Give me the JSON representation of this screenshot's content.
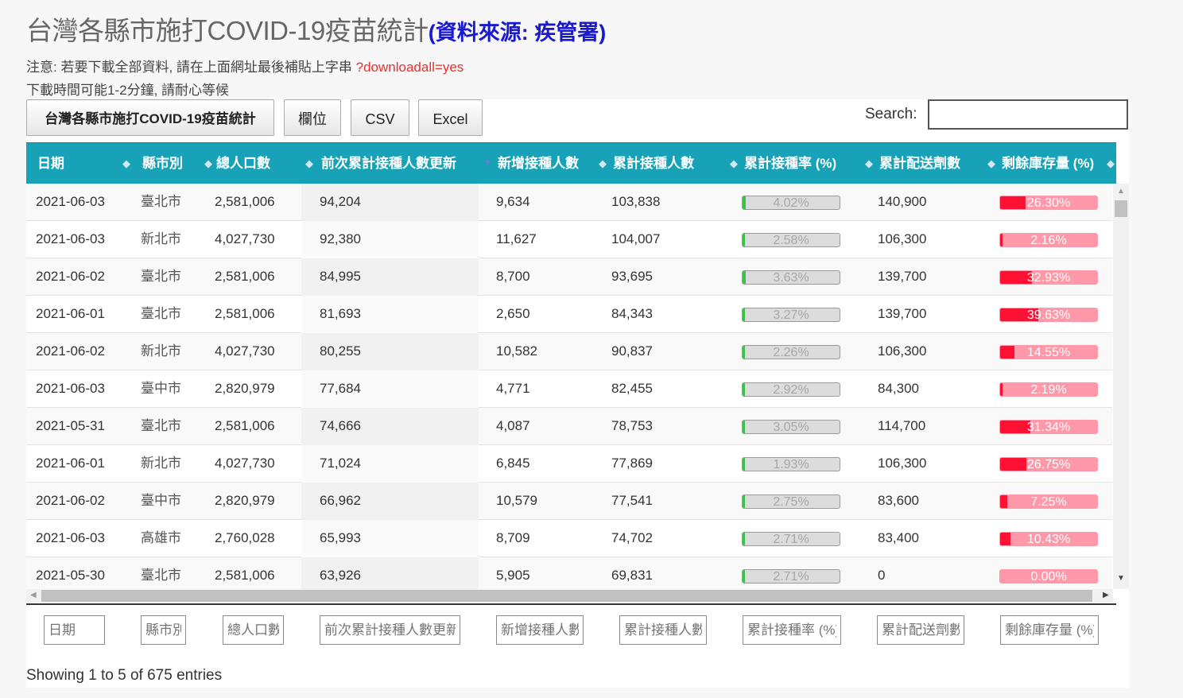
{
  "header": {
    "title": "台灣各縣市施打COVID-19疫苗統計",
    "source": "(資料來源: 疾管署)",
    "note1_prefix": "注意: 若要下載全部資料, 請在上面網址最後補貼上字串",
    "note1_query": "?downloadall=yes",
    "note2": "下載時間可能1-2分鐘, 請耐心等候"
  },
  "toolbar": {
    "title_button": "台灣各縣市施打COVID-19疫苗統計",
    "columns_button": "欄位",
    "csv_button": "CSV",
    "excel_button": "Excel",
    "search_label": "Search:",
    "search_value": ""
  },
  "table": {
    "columns": [
      "日期",
      "縣市別",
      "總人口數",
      "前次累計接種人數更新",
      "新增接種人數",
      "累計接種人數",
      "累計接種率 (%)",
      "累計配送劑數",
      "剩餘庫存量 (%)"
    ],
    "sorted_column": "前次累計接種人數更新",
    "sort_direction": "descending",
    "rows": [
      {
        "date": "2021-06-03",
        "city": "臺北市",
        "pop": "2,581,006",
        "prev": "94,204",
        "new": "9,634",
        "cum": "103,838",
        "rate": "4.02%",
        "rate_value": 4.02,
        "dist": "140,900",
        "stock": "26.30%",
        "stock_value": 26.3
      },
      {
        "date": "2021-06-03",
        "city": "新北市",
        "pop": "4,027,730",
        "prev": "92,380",
        "new": "11,627",
        "cum": "104,007",
        "rate": "2.58%",
        "rate_value": 2.58,
        "dist": "106,300",
        "stock": "2.16%",
        "stock_value": 2.16
      },
      {
        "date": "2021-06-02",
        "city": "臺北市",
        "pop": "2,581,006",
        "prev": "84,995",
        "new": "8,700",
        "cum": "93,695",
        "rate": "3.63%",
        "rate_value": 3.63,
        "dist": "139,700",
        "stock": "32.93%",
        "stock_value": 32.93
      },
      {
        "date": "2021-06-01",
        "city": "臺北市",
        "pop": "2,581,006",
        "prev": "81,693",
        "new": "2,650",
        "cum": "84,343",
        "rate": "3.27%",
        "rate_value": 3.27,
        "dist": "139,700",
        "stock": "39.63%",
        "stock_value": 39.63
      },
      {
        "date": "2021-06-02",
        "city": "新北市",
        "pop": "4,027,730",
        "prev": "80,255",
        "new": "10,582",
        "cum": "90,837",
        "rate": "2.26%",
        "rate_value": 2.26,
        "dist": "106,300",
        "stock": "14.55%",
        "stock_value": 14.55
      },
      {
        "date": "2021-06-03",
        "city": "臺中市",
        "pop": "2,820,979",
        "prev": "77,684",
        "new": "4,771",
        "cum": "82,455",
        "rate": "2.92%",
        "rate_value": 2.92,
        "dist": "84,300",
        "stock": "2.19%",
        "stock_value": 2.19
      },
      {
        "date": "2021-05-31",
        "city": "臺北市",
        "pop": "2,581,006",
        "prev": "74,666",
        "new": "4,087",
        "cum": "78,753",
        "rate": "3.05%",
        "rate_value": 3.05,
        "dist": "114,700",
        "stock": "31.34%",
        "stock_value": 31.34
      },
      {
        "date": "2021-06-01",
        "city": "新北市",
        "pop": "4,027,730",
        "prev": "71,024",
        "new": "6,845",
        "cum": "77,869",
        "rate": "1.93%",
        "rate_value": 1.93,
        "dist": "106,300",
        "stock": "26.75%",
        "stock_value": 26.75
      },
      {
        "date": "2021-06-02",
        "city": "臺中市",
        "pop": "2,820,979",
        "prev": "66,962",
        "new": "10,579",
        "cum": "77,541",
        "rate": "2.75%",
        "rate_value": 2.75,
        "dist": "83,600",
        "stock": "7.25%",
        "stock_value": 7.25
      },
      {
        "date": "2021-06-03",
        "city": "高雄市",
        "pop": "2,760,028",
        "prev": "65,993",
        "new": "8,709",
        "cum": "74,702",
        "rate": "2.71%",
        "rate_value": 2.71,
        "dist": "83,400",
        "stock": "10.43%",
        "stock_value": 10.43
      },
      {
        "date": "2021-05-30",
        "city": "臺北市",
        "pop": "2,581,006",
        "prev": "63,926",
        "new": "5,905",
        "cum": "69,831",
        "rate": "2.71%",
        "rate_value": 2.71,
        "dist": "0",
        "stock": "0.00%",
        "stock_value": 0.0
      }
    ],
    "filter_placeholders": [
      "日期",
      "縣市別",
      "總人口數",
      "前次累計接種人數更新",
      "新增接種人數",
      "累計接種人數",
      "累計接種率 (%)",
      "累計配送劑數",
      "剩餘庫存量 (%)"
    ]
  },
  "footer": {
    "info": "Showing 1 to 5 of 675 entries"
  },
  "colors": {
    "header_bg": "#17a2b8",
    "rate_bar_fill": "#3cc24a",
    "stock_bar_fill": "#ff1133",
    "stock_bar_bg": "#ff98a8",
    "query_text": "#e8312f",
    "source_text": "#1a1acc"
  }
}
